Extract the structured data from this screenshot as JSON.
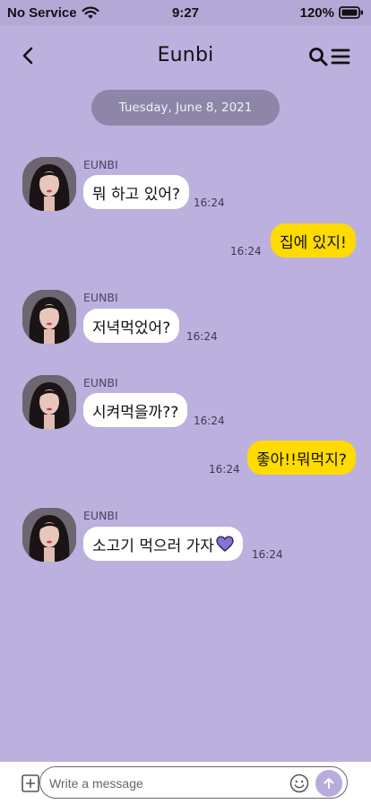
{
  "status_bar": {
    "carrier": "No Service",
    "time": "9:27",
    "battery": "120%"
  },
  "header": {
    "title": "Eunbi"
  },
  "date_divider": "Tuesday, June 8, 2021",
  "messages": [
    {
      "sender": "EUNBI",
      "text": "뭐 하고 있어?",
      "time": "16:24",
      "direction": "incoming"
    },
    {
      "text": "집에 있지!",
      "time": "16:24",
      "direction": "outgoing"
    },
    {
      "sender": "EUNBI",
      "text": "저녁먹었어?",
      "time": "16:24",
      "direction": "incoming"
    },
    {
      "sender": "EUNBI",
      "text": "시켜먹을까??",
      "time": "16:24",
      "direction": "incoming"
    },
    {
      "text": "좋아!!뭐먹지?",
      "time": "16:24",
      "direction": "outgoing"
    },
    {
      "sender": "EUNBI",
      "text": "소고기 먹으러 가자",
      "time": "16:24",
      "direction": "incoming",
      "emoji": "purple-heart"
    }
  ],
  "composer": {
    "placeholder": "Write a message"
  },
  "colors": {
    "background": "#bcb0de",
    "incoming_bubble": "#ffffff",
    "outgoing_bubble": "#ffdb00",
    "date_pill": "#8d86a8",
    "send_button": "#b9acdc",
    "heart": "#8a6fd8"
  },
  "icons": [
    "wifi-icon",
    "battery-icon",
    "back-arrow-icon",
    "search-icon",
    "menu-icon",
    "add-icon",
    "emoji-icon",
    "send-icon",
    "heart-icon"
  ]
}
